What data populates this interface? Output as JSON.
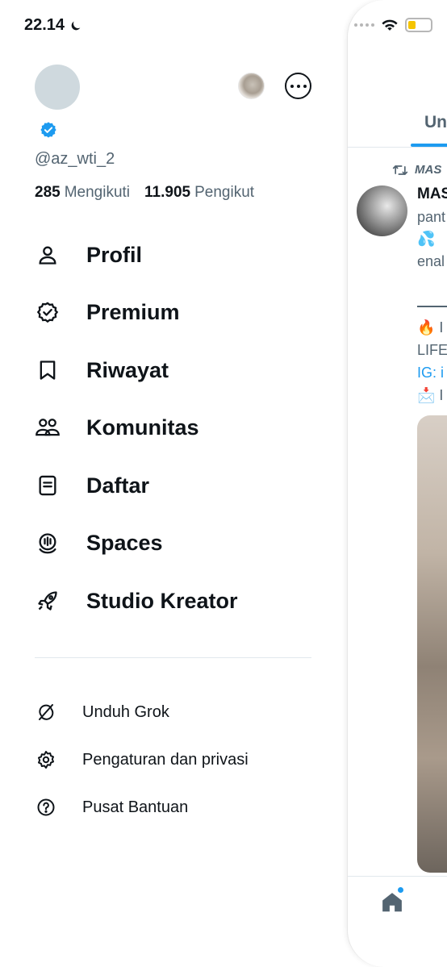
{
  "status_bar": {
    "time": "22.14"
  },
  "profile": {
    "handle": "@az_wti_2",
    "following_count": "285",
    "following_label": "Mengikuti",
    "followers_count": "11.905",
    "followers_label": "Pengikut"
  },
  "nav": [
    {
      "label": "Profil",
      "icon": "person-icon"
    },
    {
      "label": "Premium",
      "icon": "verified-badge-icon"
    },
    {
      "label": "Riwayat",
      "icon": "bookmark-icon"
    },
    {
      "label": "Komunitas",
      "icon": "communities-icon"
    },
    {
      "label": "Daftar",
      "icon": "list-icon"
    },
    {
      "label": "Spaces",
      "icon": "spaces-icon"
    },
    {
      "label": "Studio Kreator",
      "icon": "rocket-icon"
    }
  ],
  "secondary": [
    {
      "label": "Unduh Grok",
      "icon": "grok-icon"
    },
    {
      "label": "Pengaturan dan privasi",
      "icon": "gear-icon"
    },
    {
      "label": "Pusat Bantuan",
      "icon": "help-icon"
    }
  ],
  "feed_preview": {
    "tab_label": "Unt",
    "repost_text": "MAS",
    "author_name": "MAS",
    "post_lines": [
      "pant",
      "💦",
      "enal"
    ],
    "bio_lines": [
      "🔥 I",
      "LIFE",
      "IG: i",
      "📩 I"
    ]
  },
  "colors": {
    "accent": "#1d9bf0",
    "text": "#0f1419",
    "muted": "#536471",
    "divider": "#e1e8ed"
  }
}
